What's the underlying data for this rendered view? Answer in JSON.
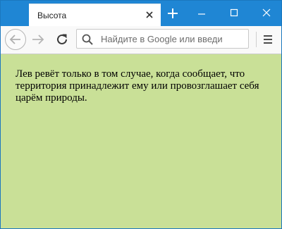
{
  "tab": {
    "title": "Высота"
  },
  "urlbar": {
    "placeholder": "Найдите в Google или введи"
  },
  "icons": {
    "close": "close-icon",
    "new_tab": "plus-icon",
    "back": "arrow-left-icon",
    "forward": "arrow-right-icon",
    "reload": "reload-icon",
    "search": "search-icon",
    "menu": "hamburger-icon"
  },
  "colors": {
    "titlebar": "#1f86d4",
    "page_background": "#c9e097"
  },
  "page": {
    "text": "Лев ревёт только в том случае, когда сообщает, что территория принадлежит ему или провозглашает себя царём природы."
  }
}
